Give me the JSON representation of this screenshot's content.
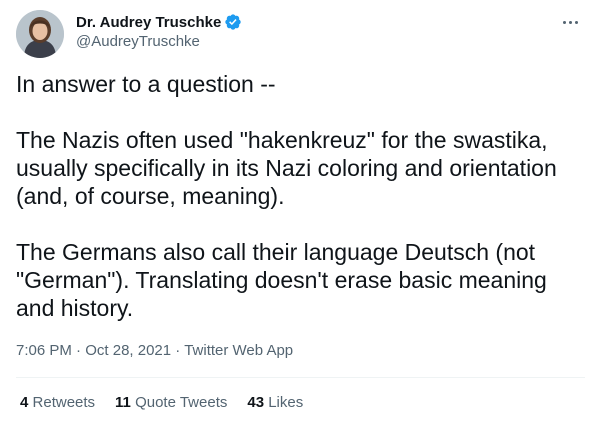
{
  "author": {
    "name": "Dr. Audrey Truschke",
    "handle": "@AudreyTruschke",
    "verified_icon": "verified-badge-icon",
    "avatar_icon": "avatar"
  },
  "tweet": {
    "lines": [
      "In answer to a question --",
      "",
      "The Nazis often used \"hakenkreuz\" for the swastika,",
      "usually specifically in its Nazi coloring and orientation",
      "(and, of course, meaning).",
      "",
      "The Germans also call their language Deutsch (not",
      "\"German\"). Translating doesn't erase basic meaning",
      "and history."
    ]
  },
  "meta": {
    "time": "7:06 PM",
    "sep1": " · ",
    "date": "Oct 28, 2021",
    "sep2": " · ",
    "source": "Twitter Web App"
  },
  "stats": {
    "retweets_count": "4",
    "retweets_label": "Retweets",
    "quotes_count": "11",
    "quotes_label": "Quote Tweets",
    "likes_count": "43",
    "likes_label": "Likes"
  },
  "colors": {
    "primary_text": "#0f1419",
    "secondary_text": "#536471",
    "verified": "#1d9bf0",
    "divider": "#eff3f4"
  }
}
